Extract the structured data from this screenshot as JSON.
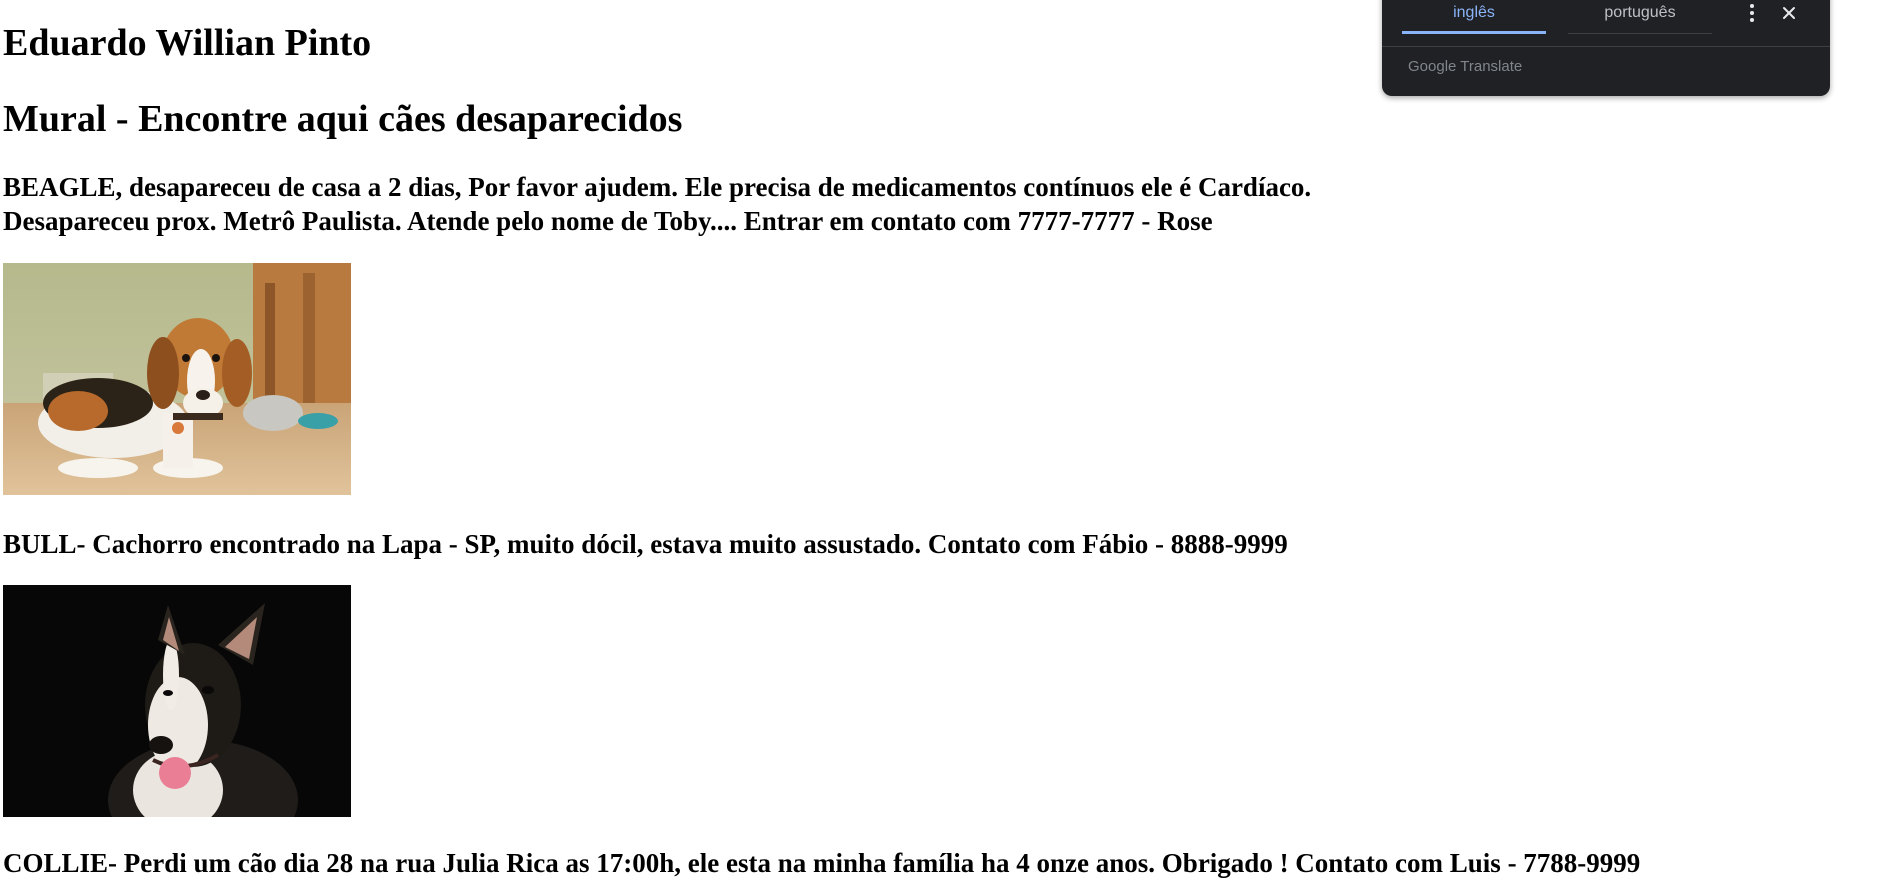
{
  "page": {
    "author_heading": "Eduardo Willian Pinto",
    "mural_heading": "Mural - Encontre aqui cães desaparecidos"
  },
  "posts": [
    {
      "text_line1": "BEAGLE, desapareceu de casa a 2 dias, Por favor ajudem. Ele precisa de medicamentos contínuos ele é Cardíaco.",
      "text_line2": "Desapareceu prox. Metrô Paulista. Atende pelo nome de Toby.... Entrar em contato com 7777-7777 - Rose",
      "photo_alt": "beagle"
    },
    {
      "text_line1": "BULL- Cachorro encontrado na Lapa - SP, muito dócil, estava muito assustado. Contato com Fábio - 8888-9999",
      "photo_alt": "bull terrier"
    },
    {
      "text_line1": "COLLIE- Perdi um cão dia 28 na rua Julia Rica as 17:00h, ele esta na minha família ha 4 onze anos. Obrigado ! Contato com Luis - 7788-9999"
    }
  ],
  "translate_popup": {
    "tab_source": "inglês",
    "tab_target": "português",
    "brand": "Google Translate",
    "menu_icon": "more-vert-icon",
    "close_icon": "close-icon",
    "accent_color": "#8ab4f8",
    "background_color": "#202124"
  }
}
